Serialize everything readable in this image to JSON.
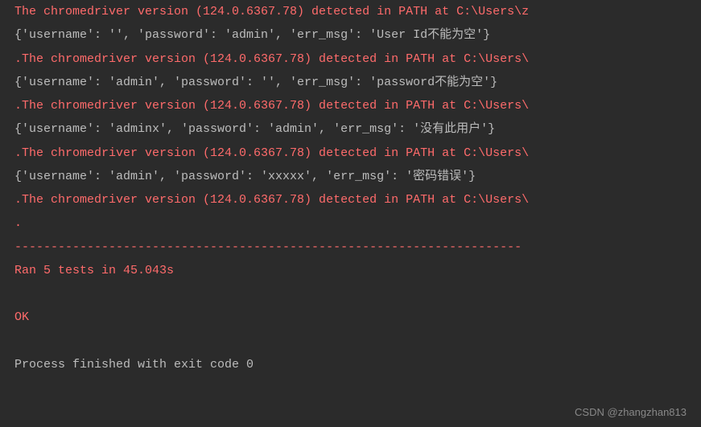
{
  "lines": {
    "l0": "The chromedriver version (124.0.6367.78) detected in PATH at C:\\Users\\z",
    "l1": "{'username': '', 'password': 'admin', 'err_msg': 'User Id不能为空'}",
    "l2": ".The chromedriver version (124.0.6367.78) detected in PATH at C:\\Users\\",
    "l3": "{'username': 'admin', 'password': '', 'err_msg': 'password不能为空'}",
    "l4": ".The chromedriver version (124.0.6367.78) detected in PATH at C:\\Users\\",
    "l5": "{'username': 'adminx', 'password': 'admin', 'err_msg': '没有此用户'}",
    "l6": ".The chromedriver version (124.0.6367.78) detected in PATH at C:\\Users\\",
    "l7": "{'username': 'admin', 'password': 'xxxxx', 'err_msg': '密码错误'}",
    "l8": ".The chromedriver version (124.0.6367.78) detected in PATH at C:\\Users\\",
    "l9": ".",
    "l10": "----------------------------------------------------------------------",
    "l11": "Ran 5 tests in 45.043s",
    "l12": " ",
    "l13": "OK",
    "l14": " ",
    "l15": "Process finished with exit code 0"
  },
  "watermark": "CSDN @zhangzhan813"
}
